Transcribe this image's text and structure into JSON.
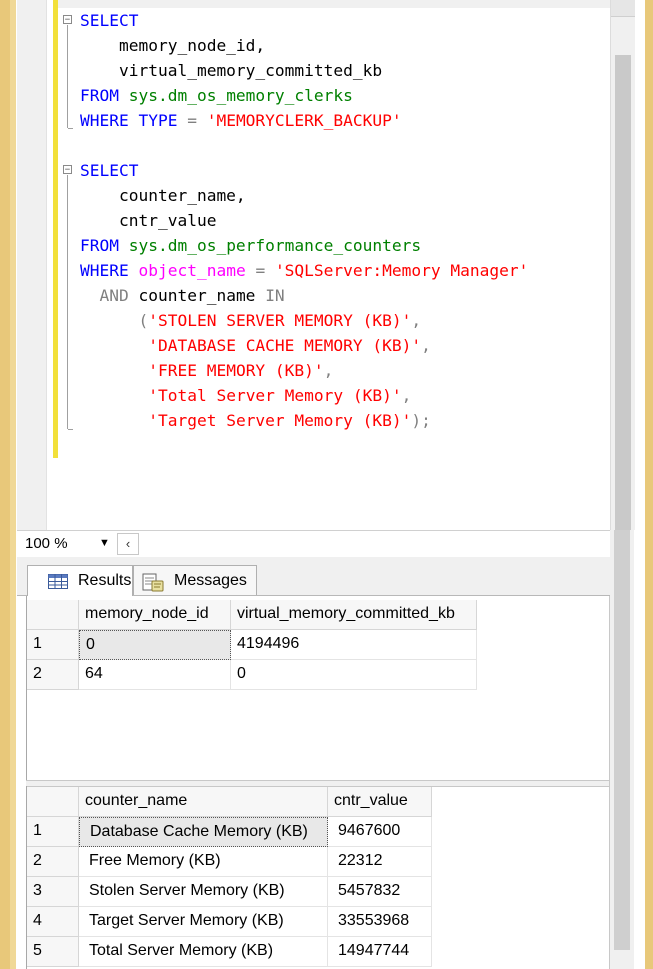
{
  "editor": {
    "lines": [
      {
        "id": "l1",
        "tokens": [
          {
            "c": "kw",
            "t": "SELECT"
          }
        ]
      },
      {
        "id": "l2",
        "tokens": [
          {
            "c": "",
            "t": "    memory_node_id,"
          }
        ]
      },
      {
        "id": "l3",
        "tokens": [
          {
            "c": "",
            "t": "    virtual_memory_committed_kb"
          }
        ]
      },
      {
        "id": "l4",
        "tokens": [
          {
            "c": "kw",
            "t": "FROM "
          },
          {
            "c": "obj",
            "t": "sys.dm_os_memory_clerks"
          }
        ]
      },
      {
        "id": "l5",
        "tokens": [
          {
            "c": "kw",
            "t": "WHERE TYPE "
          },
          {
            "c": "gray",
            "t": "= "
          },
          {
            "c": "str",
            "t": "'MEMORYCLERK_BACKUP'"
          }
        ]
      },
      {
        "id": "l6",
        "tokens": []
      },
      {
        "id": "l7",
        "tokens": [
          {
            "c": "kw",
            "t": "SELECT"
          }
        ]
      },
      {
        "id": "l8",
        "tokens": [
          {
            "c": "",
            "t": "    counter_name,"
          }
        ]
      },
      {
        "id": "l9",
        "tokens": [
          {
            "c": "",
            "t": "    cntr_value"
          }
        ]
      },
      {
        "id": "l10",
        "tokens": [
          {
            "c": "kw",
            "t": "FROM "
          },
          {
            "c": "obj",
            "t": "sys.dm_os_performance_counters"
          }
        ]
      },
      {
        "id": "l11",
        "tokens": [
          {
            "c": "kw",
            "t": "WHERE "
          },
          {
            "c": "fn",
            "t": "object_name "
          },
          {
            "c": "gray",
            "t": "= "
          },
          {
            "c": "str",
            "t": "'SQLServer:Memory Manager'"
          }
        ]
      },
      {
        "id": "l12",
        "tokens": [
          {
            "c": "gray",
            "t": "  AND "
          },
          {
            "c": "",
            "t": "counter_name "
          },
          {
            "c": "gray",
            "t": "IN"
          }
        ]
      },
      {
        "id": "l13",
        "tokens": [
          {
            "c": "gray",
            "t": "      ("
          },
          {
            "c": "str",
            "t": "'STOLEN SERVER MEMORY (KB)'"
          },
          {
            "c": "gray",
            "t": ","
          }
        ]
      },
      {
        "id": "l14",
        "tokens": [
          {
            "c": "",
            "t": "       "
          },
          {
            "c": "str",
            "t": "'DATABASE CACHE MEMORY (KB)'"
          },
          {
            "c": "gray",
            "t": ","
          }
        ]
      },
      {
        "id": "l15",
        "tokens": [
          {
            "c": "",
            "t": "       "
          },
          {
            "c": "str",
            "t": "'FREE MEMORY (KB)'"
          },
          {
            "c": "gray",
            "t": ","
          }
        ]
      },
      {
        "id": "l16",
        "tokens": [
          {
            "c": "",
            "t": "       "
          },
          {
            "c": "str",
            "t": "'Total Server Memory (KB)'"
          },
          {
            "c": "gray",
            "t": ","
          }
        ]
      },
      {
        "id": "l17",
        "tokens": [
          {
            "c": "",
            "t": "       "
          },
          {
            "c": "str",
            "t": "'Target Server Memory (KB)'"
          },
          {
            "c": "gray",
            "t": ");"
          }
        ]
      }
    ]
  },
  "zoom": {
    "value": "100 %"
  },
  "tabs": {
    "results": "Results",
    "messages": "Messages"
  },
  "grid1": {
    "headers": [
      "memory_node_id",
      "virtual_memory_committed_kb"
    ],
    "rows": [
      {
        "num": "1",
        "cells": [
          "0",
          "4194496"
        ]
      },
      {
        "num": "2",
        "cells": [
          "64",
          "0"
        ]
      }
    ]
  },
  "grid2": {
    "headers": [
      "counter_name",
      "cntr_value"
    ],
    "rows": [
      {
        "num": "1",
        "cells": [
          "Database Cache Memory (KB)",
          "9467600"
        ]
      },
      {
        "num": "2",
        "cells": [
          "Free Memory (KB)",
          "22312"
        ]
      },
      {
        "num": "3",
        "cells": [
          "Stolen Server Memory (KB)",
          "5457832"
        ]
      },
      {
        "num": "4",
        "cells": [
          "Target Server Memory (KB)",
          "33553968"
        ]
      },
      {
        "num": "5",
        "cells": [
          "Total Server Memory (KB)",
          "14947744"
        ]
      }
    ]
  }
}
